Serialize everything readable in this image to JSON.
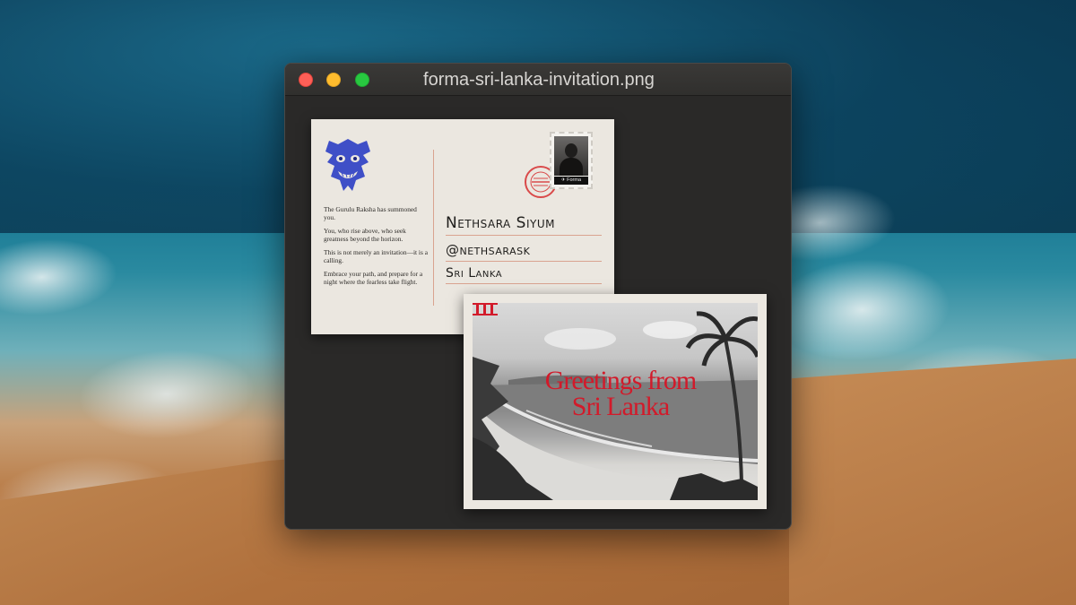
{
  "window": {
    "title": "forma-sri-lanka-invitation.png"
  },
  "postcard_back": {
    "message": [
      "The Gurulu Raksha has summoned you.",
      "You, who rise above, who seek greatness beyond the horizon.",
      "This is not merely an invitation—it is a calling.",
      "Embrace your path, and prepare for a night where the fearless take flight."
    ],
    "name": "Nethsara Siyum",
    "handle": "@nethsarask",
    "country": "Sri Lanka",
    "stamp_label": "✈ Forma",
    "icon": "raksha-mask-icon"
  },
  "postcard_front": {
    "title_line1": "Greetings from",
    "title_line2": "Sri Lanka",
    "accent_color": "#d21a2a"
  },
  "colors": {
    "window_bg": "#2a2928",
    "card": "#ebe7e0",
    "mask_blue": "#3f4fc7"
  }
}
